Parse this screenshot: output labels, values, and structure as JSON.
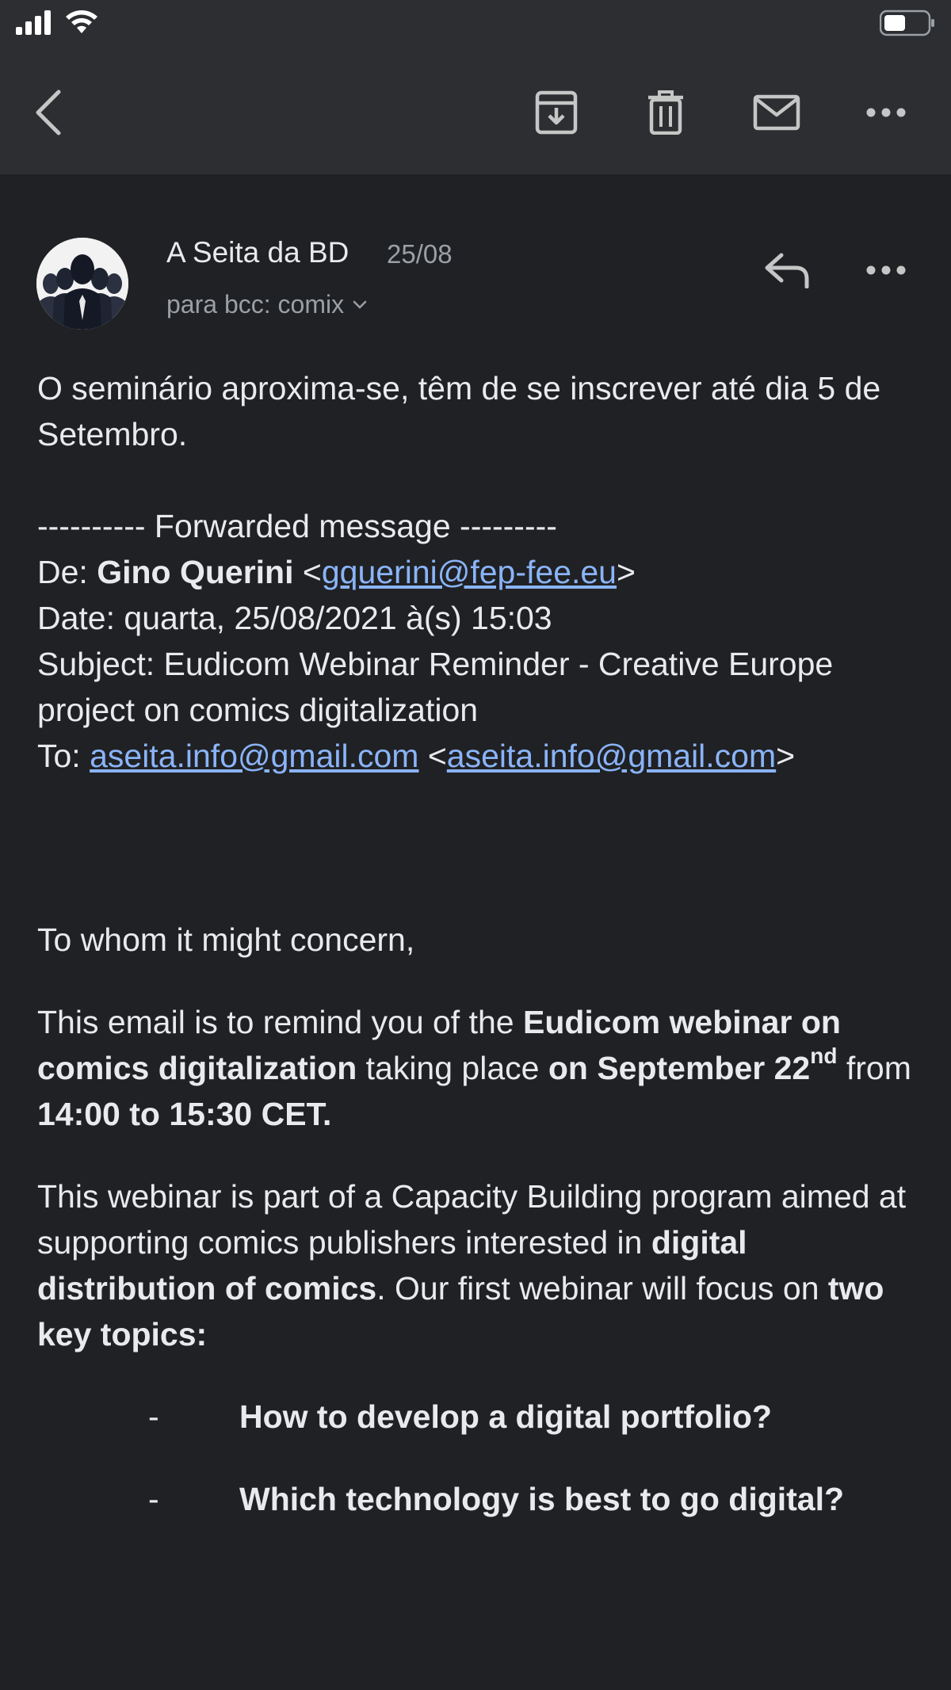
{
  "toolbar": {
    "back_icon": "chevron-left-icon",
    "archive_icon": "archive-icon",
    "delete_icon": "trash-icon",
    "mark_unread_icon": "mail-icon",
    "more_icon": "more-horizontal-icon"
  },
  "message": {
    "sender": "A Seita da BD",
    "date": "25/08",
    "recipient": "para bcc: comix",
    "intro": "O seminário aproxima-se, têm de se inscrever até dia 5 de Setembro.",
    "forward_header": "---------- Forwarded message ---------",
    "from_label": "De: ",
    "from_name": "Gino Querini",
    "from_email": "gquerini@fep-fee.eu",
    "date_line": "Date: quarta, 25/08/2021 à(s) 15:03",
    "subject_line": "Subject: Eudicom Webinar Reminder - Creative Europe project on comics digitalization",
    "to_label": "To: ",
    "to_email": "aseita.info@gmail.com",
    "to_email_2": "aseita.info@gmail.com",
    "greeting": "To whom it might concern,",
    "p1_a": "This email is to remind you of the ",
    "p1_b": "Eudicom webinar on comics digitalization",
    "p1_c": " taking place ",
    "p1_d": "on September 22",
    "p1_sup": "nd",
    "p1_e": " from ",
    "p1_f": "14:00 to 15:30 CET.",
    "p2_a": "This webinar is part of a Capacity Building program aimed at supporting comics publishers interested in ",
    "p2_b": "digital distribution of comics",
    "p2_c": ". Our first webinar will focus on ",
    "p2_d": "two key topics:",
    "bullet_dash": "-",
    "topic_1": "How to develop a digital portfolio?",
    "topic_2": "Which technology is best to go digital?"
  },
  "colors": {
    "background": "#202124",
    "toolbar": "#2d2e31",
    "link": "#8ab4f8",
    "secondary_text": "#9aa0a6"
  }
}
